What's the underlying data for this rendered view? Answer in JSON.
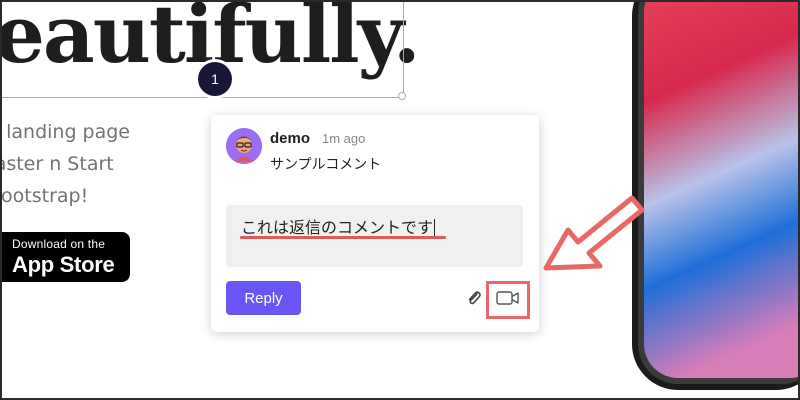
{
  "hero": {
    "title": "eautifully.",
    "subtitle": "p landing page faster n Start Bootstrap!"
  },
  "app_store": {
    "small_text": "Download on the",
    "big_text": "App Store"
  },
  "comment_pin": {
    "number": "1"
  },
  "comment": {
    "author": "demo",
    "time": "1m ago",
    "text": "サンプルコメント",
    "avatar_icon": "avatar-illustration-icon"
  },
  "reply": {
    "input_value": "これは返信のコメントです",
    "button_label": "Reply",
    "attach_icon": "paperclip-icon",
    "video_icon": "video-camera-icon"
  },
  "colors": {
    "accent": "#6a55f5",
    "pin": "#191739",
    "annotation": "#e86868"
  }
}
